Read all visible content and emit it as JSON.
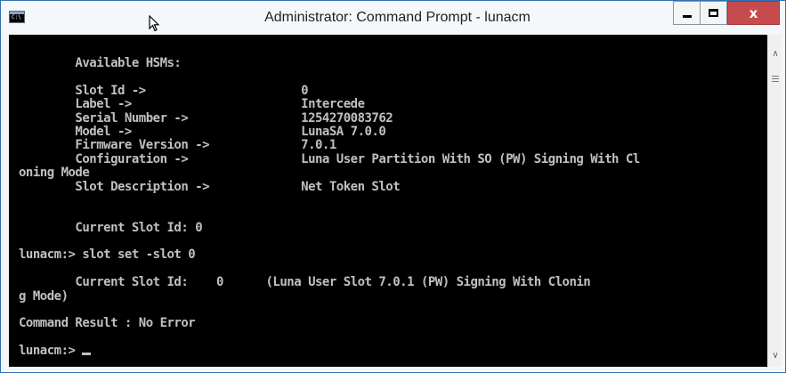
{
  "window": {
    "title": "Administrator: Command Prompt - lunacm",
    "icon_text": "C:\\",
    "controls": {
      "minimize": "minimize-icon",
      "maximize": "maximize-icon",
      "close_label": "x"
    }
  },
  "console": {
    "lines": [
      "        Available HSMs:",
      "",
      "        Slot Id ->                      0",
      "        Label ->                        Intercede",
      "        Serial Number ->                1254270083762",
      "        Model ->                        LunaSA 7.0.0",
      "        Firmware Version ->             7.0.1",
      "        Configuration ->                Luna User Partition With SO (PW) Signing With Cl",
      "oning Mode",
      "        Slot Description ->             Net Token Slot",
      "",
      "",
      "        Current Slot Id: 0",
      "",
      "lunacm:> slot set -slot 0",
      "",
      "        Current Slot Id:    0      (Luna User Slot 7.0.1 (PW) Signing With Clonin",
      "g Mode)",
      "",
      "Command Result : No Error",
      ""
    ],
    "prompt": "lunacm:> "
  },
  "colors": {
    "console_bg": "#000000",
    "console_text": "#c0c0c0",
    "close_button": "#c74a4c",
    "title_bar": "#f5f8fb"
  }
}
